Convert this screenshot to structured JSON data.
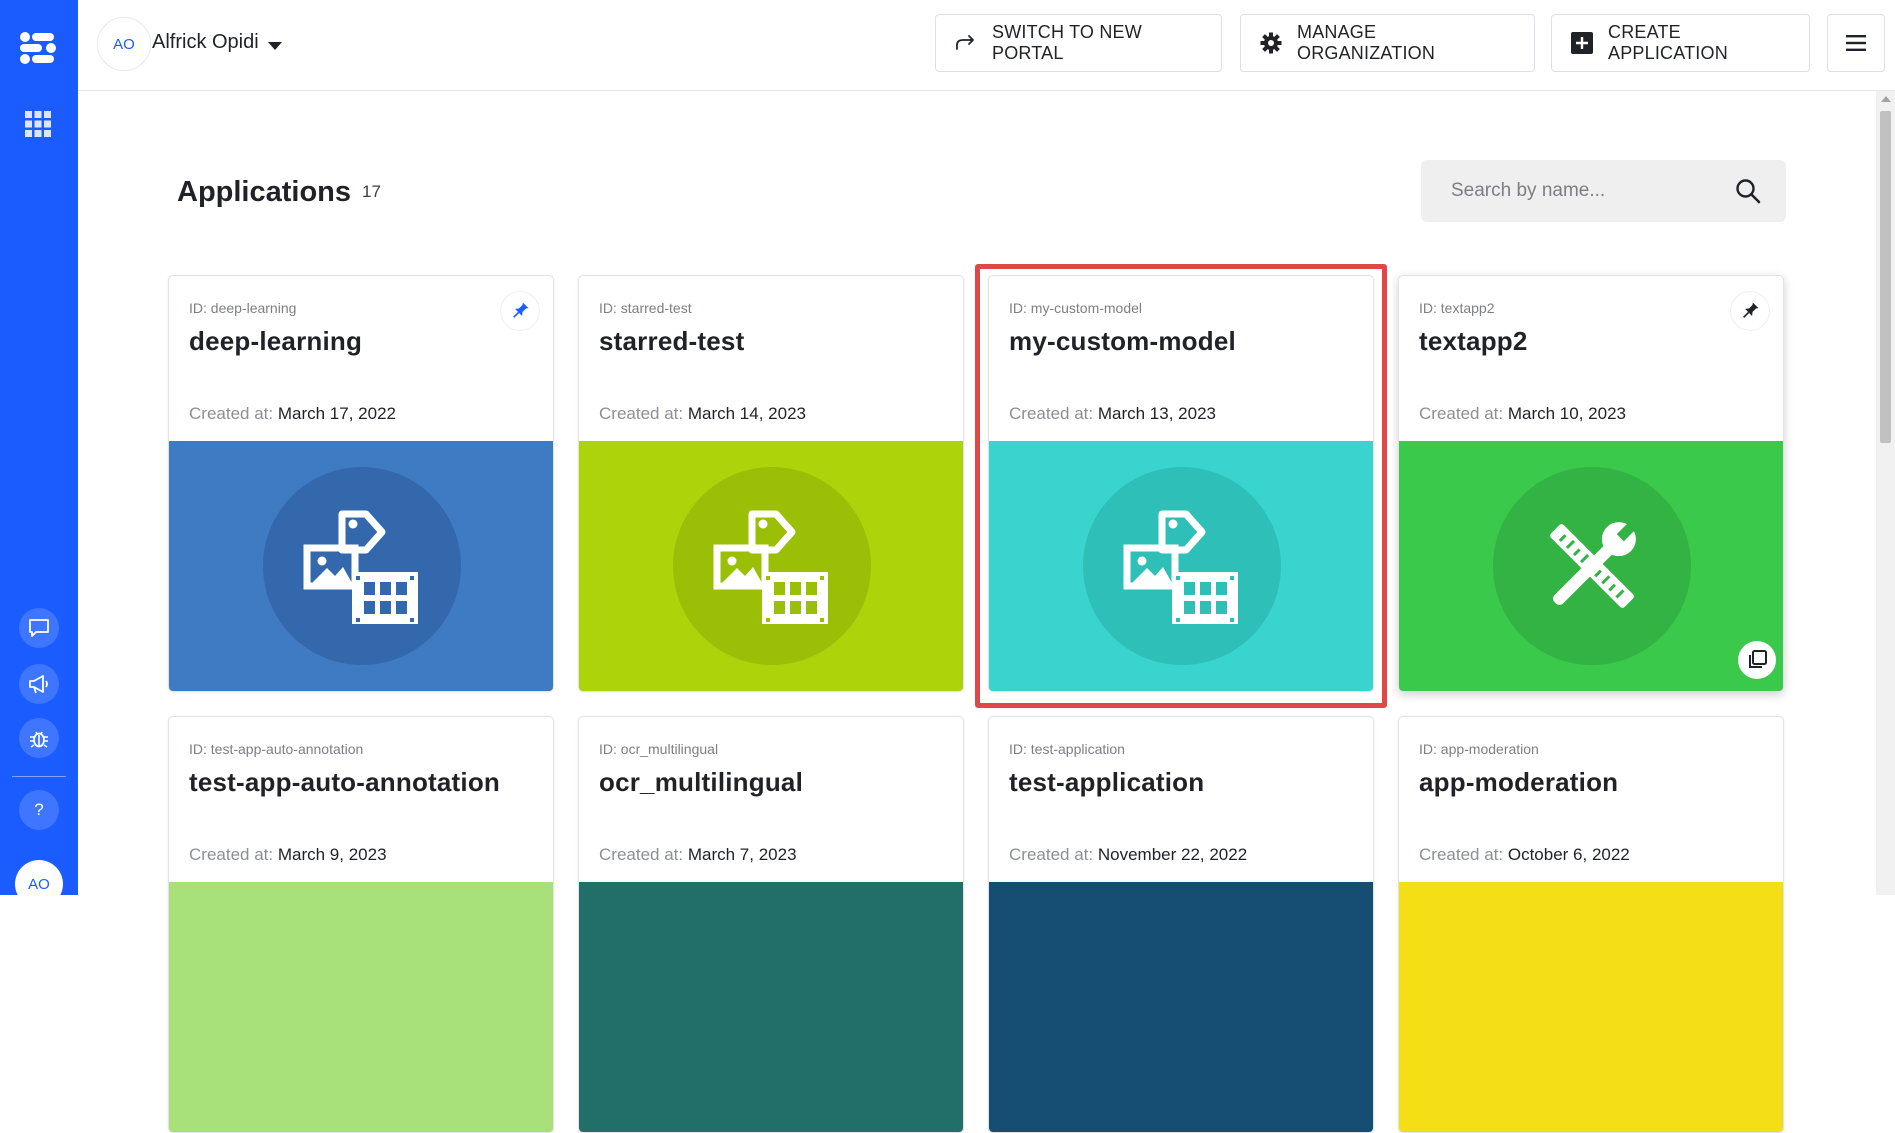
{
  "user": {
    "initials": "AO",
    "name": "Alfrick Opidi"
  },
  "topbar": {
    "switch_portal_label": "SWITCH TO NEW PORTAL",
    "manage_org_label": "MANAGE ORGANIZATION",
    "create_app_label": "CREATE APPLICATION"
  },
  "sidebar": {
    "help_label": "?",
    "avatar_initials": "AO"
  },
  "page": {
    "title": "Applications",
    "count": "17"
  },
  "search": {
    "placeholder": "Search by name..."
  },
  "created_label": "Created at:",
  "colors": {
    "brand": "#1a5cff",
    "highlight": "#e04848"
  },
  "apps": [
    {
      "id_text": "ID: deep-learning",
      "name": "deep-learning",
      "created": "March 17, 2022",
      "color": "#3f7bc3",
      "disc": "#3468ad",
      "icon": "image-video-tag-icon",
      "pinned": true
    },
    {
      "id_text": "ID: starred-test",
      "name": "starred-test",
      "created": "March 14, 2023",
      "color": "#add40a",
      "disc": "#9bbe07",
      "icon": "image-video-tag-icon",
      "pinned": false
    },
    {
      "id_text": "ID: my-custom-model",
      "name": "my-custom-model",
      "created": "March 13, 2023",
      "color": "#38d4cd",
      "disc": "#2ebfb9",
      "icon": "image-video-tag-icon",
      "pinned": false,
      "highlighted": true
    },
    {
      "id_text": "ID: textapp2",
      "name": "textapp2",
      "created": "March 10, 2023",
      "color": "#3ac94b",
      "disc": "#33b343",
      "icon": "wrench-ruler-icon",
      "pinned": false
    },
    {
      "id_text": "ID: test-app-auto-annotation",
      "name": "test-app-auto-annotation",
      "created": "March 9, 2023",
      "color": "#a8e07a"
    },
    {
      "id_text": "ID: ocr_multilingual",
      "name": "ocr_multilingual",
      "created": "March 7, 2023",
      "color": "#226f6a"
    },
    {
      "id_text": "ID: test-application",
      "name": "test-application",
      "created": "November 22, 2022",
      "color": "#154d73"
    },
    {
      "id_text": "ID: app-moderation",
      "name": "app-moderation",
      "created": "October 6, 2022",
      "color": "#f4de16"
    }
  ]
}
